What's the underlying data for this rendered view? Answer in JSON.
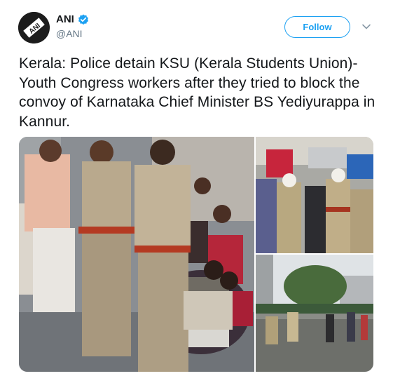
{
  "author": {
    "name": "ANI",
    "handle": "@ANI",
    "avatar_text": "ANI",
    "verified_icon": "verified-badge-icon"
  },
  "follow_label": "Follow",
  "more_icon": "chevron-down-icon",
  "tweet_text": "Kerala: Police detain KSU (Kerala Students Union)-Youth Congress workers after they tried to block the convoy of Karnataka Chief Minister BS Yediyurappa in Kannur.",
  "media": [
    {
      "description_name": "photo-police-detain-protesters"
    },
    {
      "description_name": "photo-police-crowd-street"
    },
    {
      "description_name": "photo-street-scene-police"
    }
  ],
  "colors": {
    "accent": "#1da1f2",
    "text": "#14171a",
    "secondary": "#657786"
  }
}
